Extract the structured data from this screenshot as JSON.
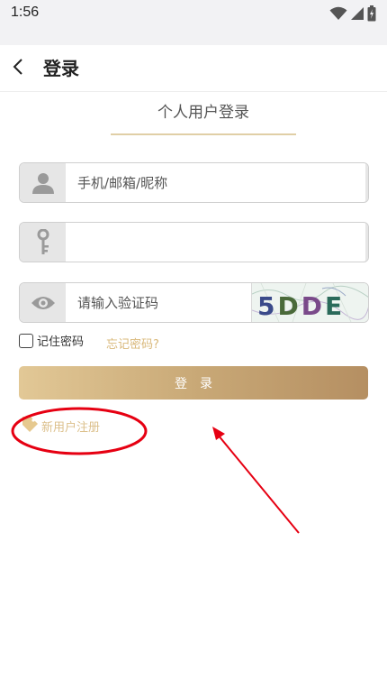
{
  "status_bar": {
    "time": "1:56"
  },
  "header": {
    "title": "登录"
  },
  "login_tab": {
    "label": "个人用户登录"
  },
  "fields": {
    "account": {
      "placeholder": "手机/邮箱/昵称",
      "value": ""
    },
    "password": {
      "placeholder": "",
      "value": ""
    },
    "captcha": {
      "placeholder": "请输入验证码",
      "value": "",
      "image_text": "5DDE"
    }
  },
  "options": {
    "remember_label": "记住密码",
    "forgot_label": "忘记密码?"
  },
  "login_button": {
    "label": "登录"
  },
  "register": {
    "label": "新用户注册"
  },
  "colors": {
    "accent": "#d9b87a",
    "button_start": "#e2c896",
    "button_end": "#b58f62",
    "annotation": "#e60012"
  },
  "icons": {
    "wifi": "wifi-icon",
    "signal": "signal-icon",
    "battery": "battery-icon",
    "back": "chevron-left-icon",
    "user": "user-icon",
    "key": "key-icon",
    "eye": "eye-icon",
    "register": "tag-icon"
  }
}
